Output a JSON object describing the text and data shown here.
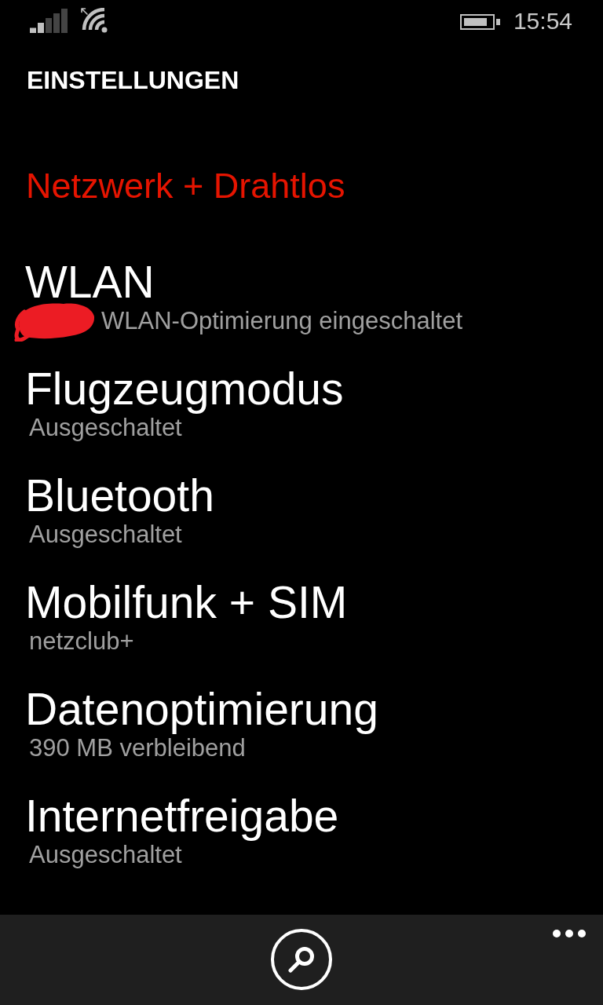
{
  "status_bar": {
    "time": "15:54"
  },
  "page_title": "EINSTELLUNGEN",
  "section_title": "Netzwerk + Drahtlos",
  "settings": [
    {
      "title": "WLAN",
      "status": "WLAN-Optimierung eingeschaltet",
      "redacted": true
    },
    {
      "title": "Flugzeugmodus",
      "status": "Ausgeschaltet",
      "redacted": false
    },
    {
      "title": "Bluetooth",
      "status": "Ausgeschaltet",
      "redacted": false
    },
    {
      "title": "Mobilfunk + SIM",
      "status": "netzclub+",
      "redacted": false
    },
    {
      "title": "Datenoptimierung",
      "status": "390 MB verbleibend",
      "redacted": false
    },
    {
      "title": "Internetfreigabe",
      "status": "Ausgeschaltet",
      "redacted": false
    }
  ]
}
